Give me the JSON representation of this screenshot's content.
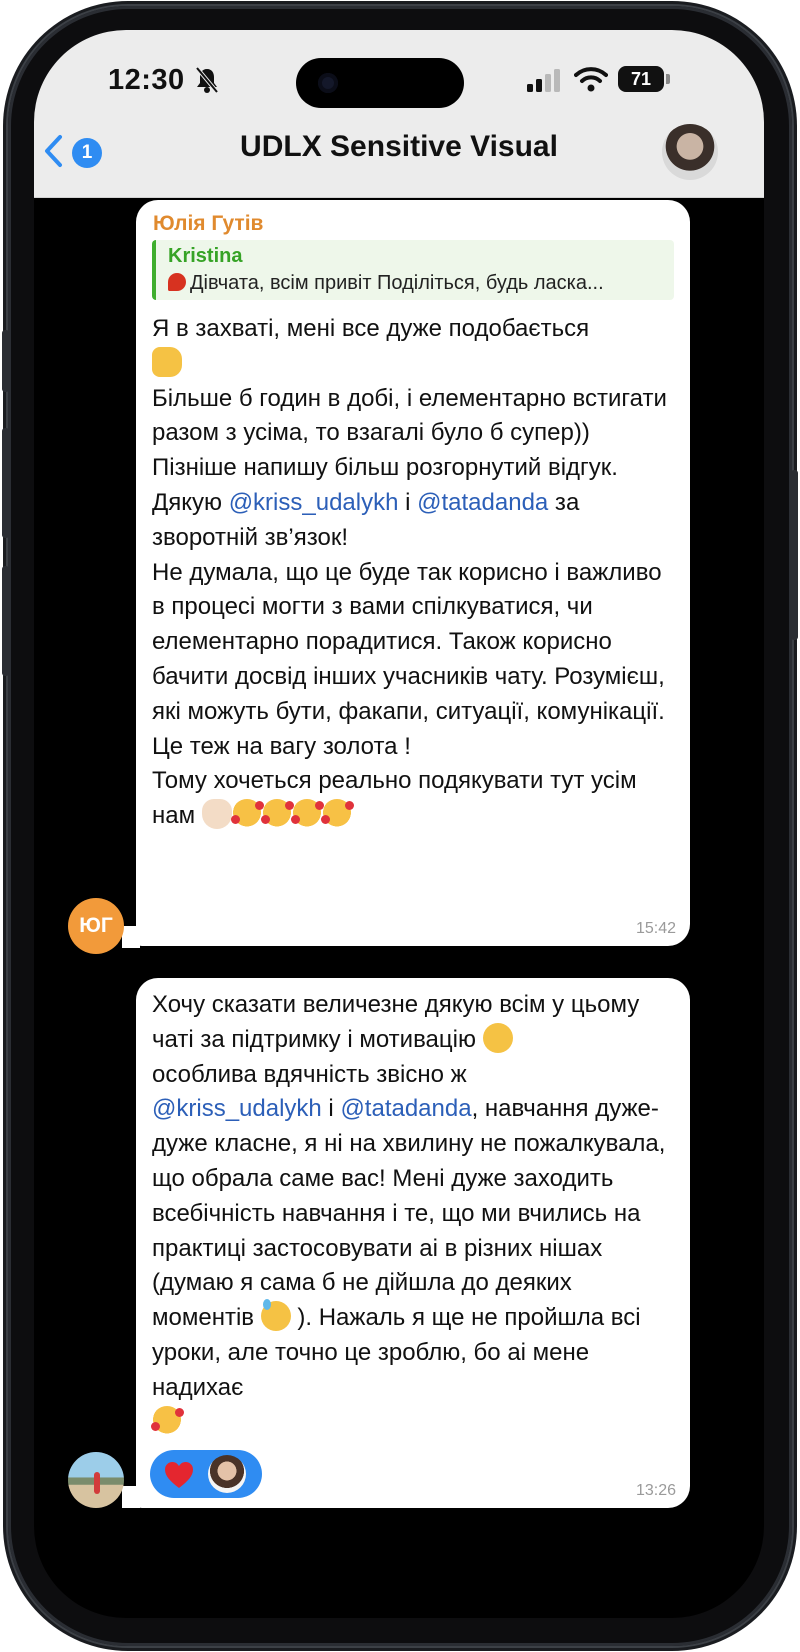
{
  "status_bar": {
    "time": "12:30",
    "battery": "71"
  },
  "header": {
    "unread_count": "1",
    "title": "UDLX Sensitive Visual"
  },
  "messages": [
    {
      "sender": "Юлія Гутів",
      "avatar_initials": "ЮГ",
      "reply": {
        "author": "Kristina",
        "text": "Дівчата, всім привіт Поділіться, будь ласка..."
      },
      "text_parts": {
        "p1": "Я в захваті, мені все дуже подобається",
        "p2": "Більше б годин в добі, і елементарно встигати разом з усіма, то взагалі було б супер))\nПізніше напишу більш розгорнутий відгук.\nДякую ",
        "mention1": "@kriss_udalykh",
        "p3": " і ",
        "mention2": "@tatadanda",
        "p4": " за зворотній зв’язок!\nНе думала, що це буде так корисно і важливо в процесі могти з вами спілкуватися, чи елементарно порадитися. Також корисно бачити досвід інших учасників чату. Розумієш, які можуть бути, факапи, ситуації, комунікації. Це теж на вагу золота !\nТому хочеться реально подякувати тут усім нам"
      },
      "time": "15:42"
    },
    {
      "text_parts": {
        "p1": "Хочу сказати величезне дякую всім у цьому чаті за підтримку і мотивацію",
        "p2": "\nособлива вдячність звісно ж\n",
        "mention1": "@kriss_udalykh",
        "p3": " і ",
        "mention2": "@tatadanda",
        "p4": ", навчання дуже-дуже класне, я ні на хвилину не пожалкувала, що обрала саме вас! Мені дуже заходить всебічність навчання і те, що ми вчились на практиці застосовувати аі в різних нішах (думаю я сама б не дійшла до деяких моментів ",
        "p5": "). Нажаль я ще не пройшла всі уроки, але точно це зроблю, бо аі мене надихає"
      },
      "time": "13:26"
    }
  ],
  "icons": {
    "status": [
      "bell-slash-icon",
      "signal-icon",
      "wifi-icon",
      "battery-icon"
    ],
    "emoji": [
      "thumbs-up",
      "clapping-hands",
      "smiling-face-with-hearts",
      "hugging-face",
      "grinning-face-with-sweat"
    ],
    "reaction": "heart-icon"
  },
  "colors": {
    "accent_blue": "#2f8cf2",
    "sender_orange": "#e08a2e",
    "reply_green": "#36a326",
    "mention_blue": "#2c5fb8"
  }
}
